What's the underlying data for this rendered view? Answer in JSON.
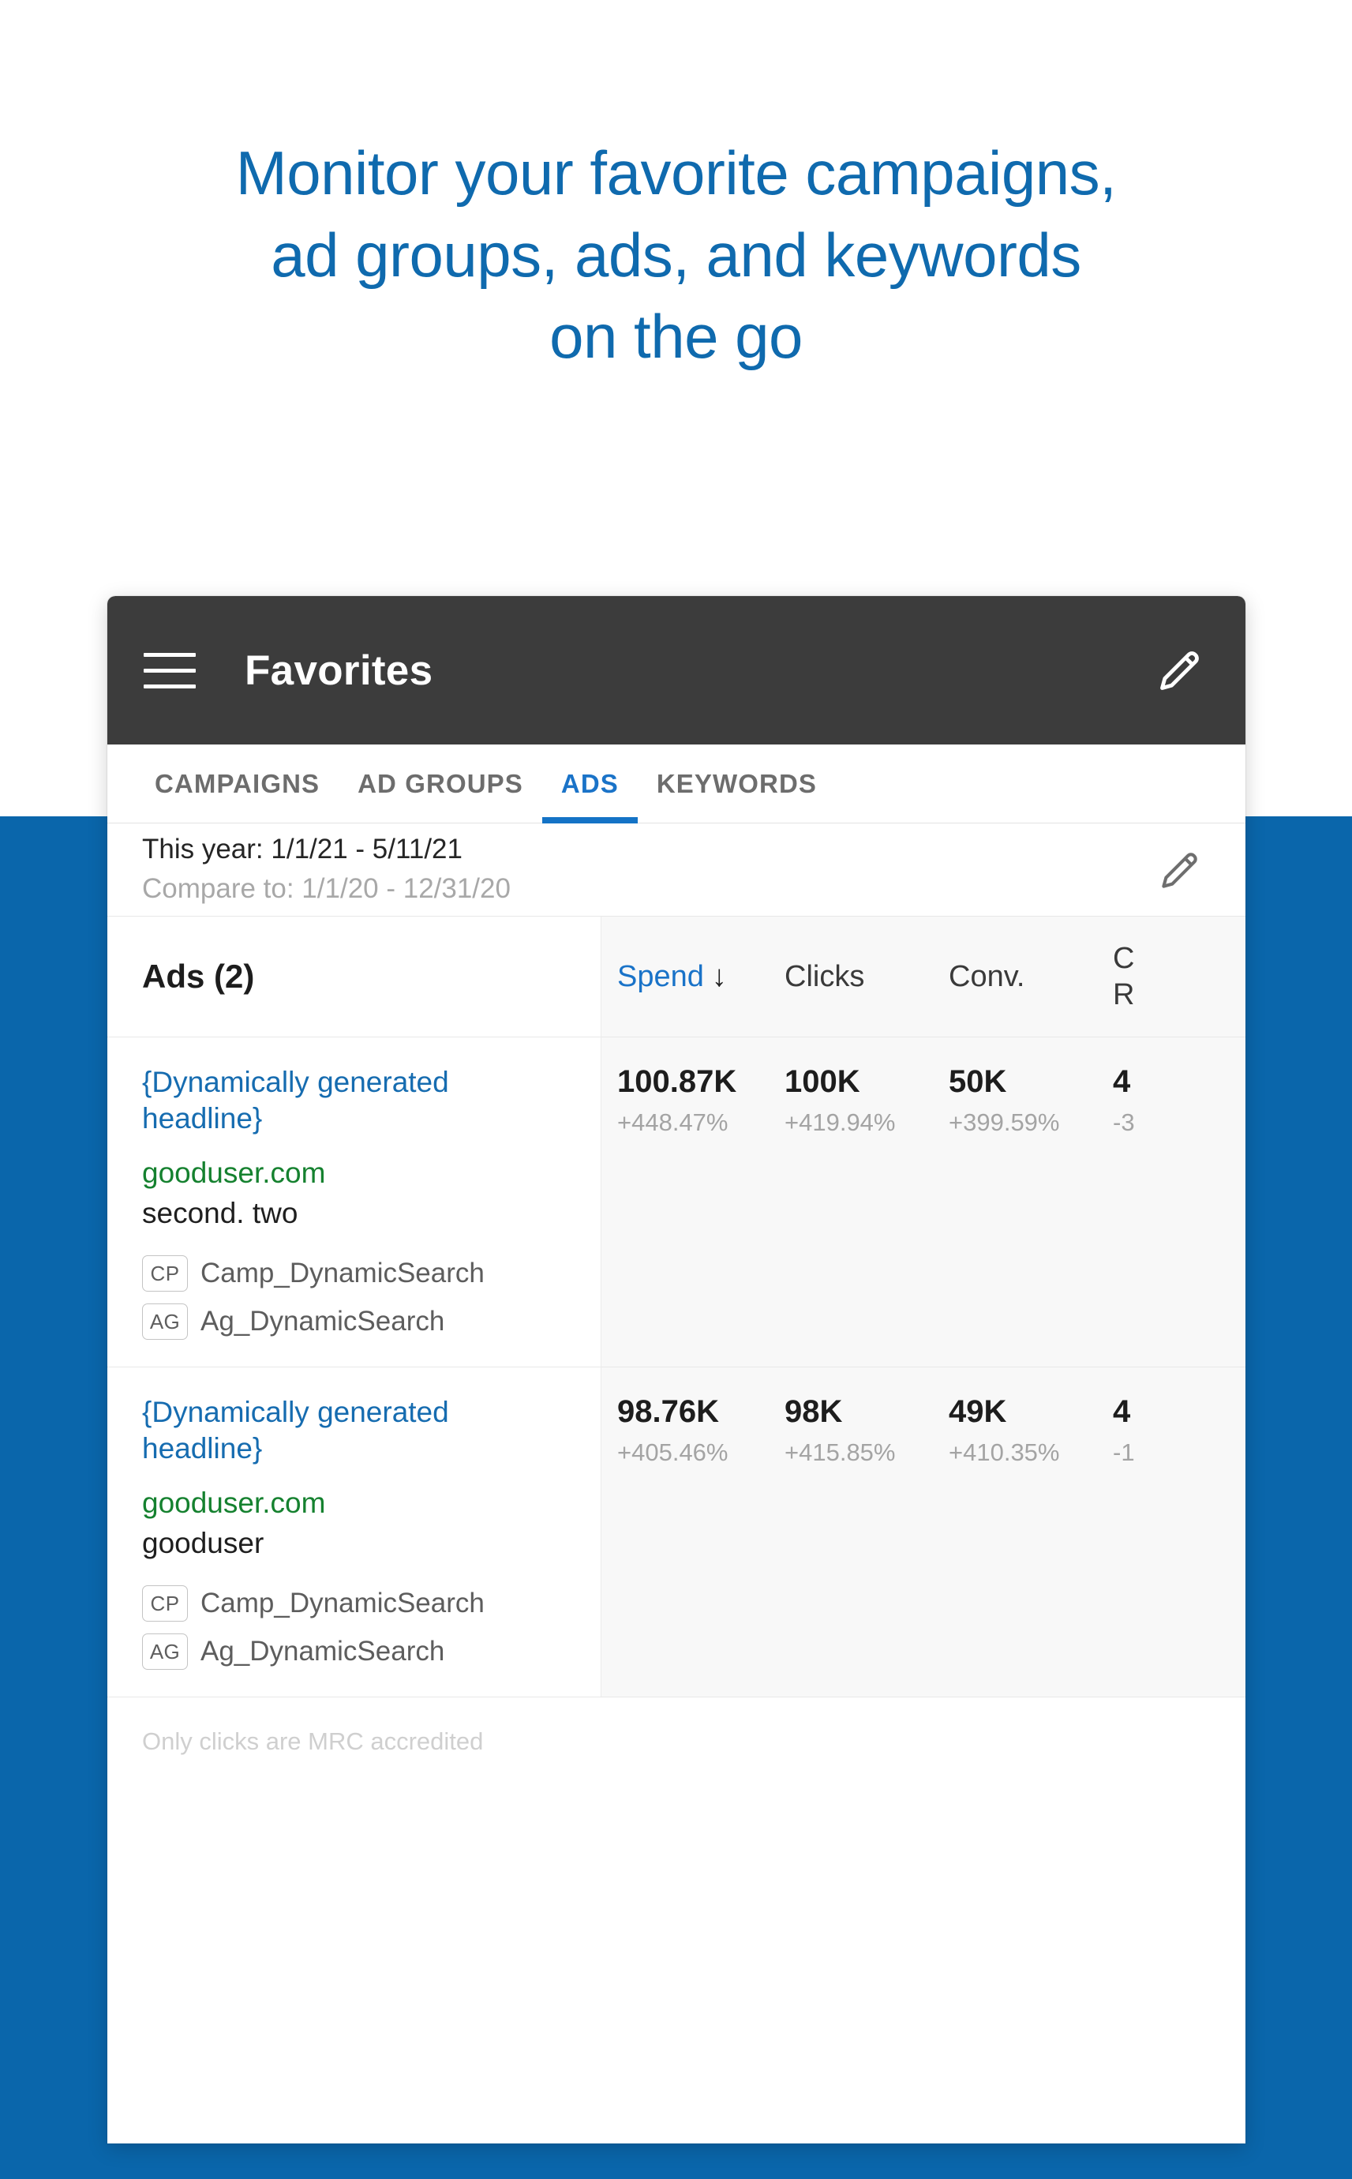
{
  "headline": "Monitor your favorite campaigns,\nad groups, ads, and keywords\non the go",
  "colors": {
    "headline": "#0f6aae",
    "backdrop": "#0a66ab",
    "toolbar": "#3c3c3c",
    "accent": "#1473c6",
    "url_green": "#15812f"
  },
  "toolbar": {
    "title": "Favorites",
    "menu_icon": "hamburger-icon",
    "edit_icon": "pencil-icon"
  },
  "tabs": [
    {
      "label": "CAMPAIGNS",
      "active": false
    },
    {
      "label": "AD GROUPS",
      "active": false
    },
    {
      "label": "ADS",
      "active": true
    },
    {
      "label": "KEYWORDS",
      "active": false
    }
  ],
  "date_range": {
    "primary": "This year: 1/1/21 - 5/11/21",
    "compare": "Compare to: 1/1/20 -  12/31/20",
    "edit_icon": "pencil-icon"
  },
  "table": {
    "title": "Ads (2)",
    "columns": [
      {
        "label": "Spend",
        "sorted": true,
        "sort_direction": "↓"
      },
      {
        "label": "Clicks",
        "sorted": false,
        "sort_direction": ""
      },
      {
        "label": "Conv.",
        "sorted": false,
        "sort_direction": ""
      },
      {
        "label": "C\nR",
        "sorted": false,
        "sort_direction": ""
      }
    ],
    "rows": [
      {
        "headline": "{Dynamically generated headline}",
        "url": "gooduser.com",
        "description": "second. two",
        "campaign_chip": "CP",
        "campaign": "Camp_DynamicSearch",
        "adgroup_chip": "AG",
        "adgroup": "Ag_DynamicSearch",
        "metrics": [
          {
            "value": "100.87K",
            "delta": "+448.47%"
          },
          {
            "value": "100K",
            "delta": "+419.94%"
          },
          {
            "value": "50K",
            "delta": "+399.59%"
          },
          {
            "value": "4",
            "delta": "-3"
          }
        ]
      },
      {
        "headline": "{Dynamically generated headline}",
        "url": "gooduser.com",
        "description": "gooduser",
        "campaign_chip": "CP",
        "campaign": "Camp_DynamicSearch",
        "adgroup_chip": "AG",
        "adgroup": "Ag_DynamicSearch",
        "metrics": [
          {
            "value": "98.76K",
            "delta": "+405.46%"
          },
          {
            "value": "98K",
            "delta": "+415.85%"
          },
          {
            "value": "49K",
            "delta": "+410.35%"
          },
          {
            "value": "4",
            "delta": "-1"
          }
        ]
      }
    ],
    "footnote": "Only clicks are MRC accredited"
  }
}
